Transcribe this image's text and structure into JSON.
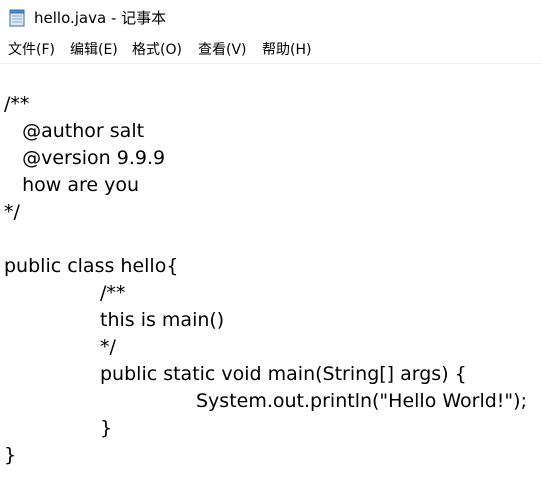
{
  "window": {
    "title": "hello.java - 记事本"
  },
  "menu": [
    {
      "label": "文件(F)"
    },
    {
      "label": "编辑(E)"
    },
    {
      "label": "格式(O)"
    },
    {
      "label": "查看(V)"
    },
    {
      "label": "帮助(H)"
    }
  ],
  "editor": {
    "lines": [
      "/**",
      "   @author salt",
      "   @version 9.9.9",
      "   how are you",
      "*/",
      "",
      "public class hello{",
      "\t\t/**",
      "\t\tthis is main()",
      "\t\t*/",
      "\t\tpublic static void main(String[] args) {",
      "\t\t\t\tSystem.out.println(\"Hello World!\");",
      "\t\t}",
      "}"
    ]
  },
  "icons": {
    "app": "notepad-icon"
  },
  "colors": {
    "text": "#000000",
    "background": "#ffffff"
  }
}
